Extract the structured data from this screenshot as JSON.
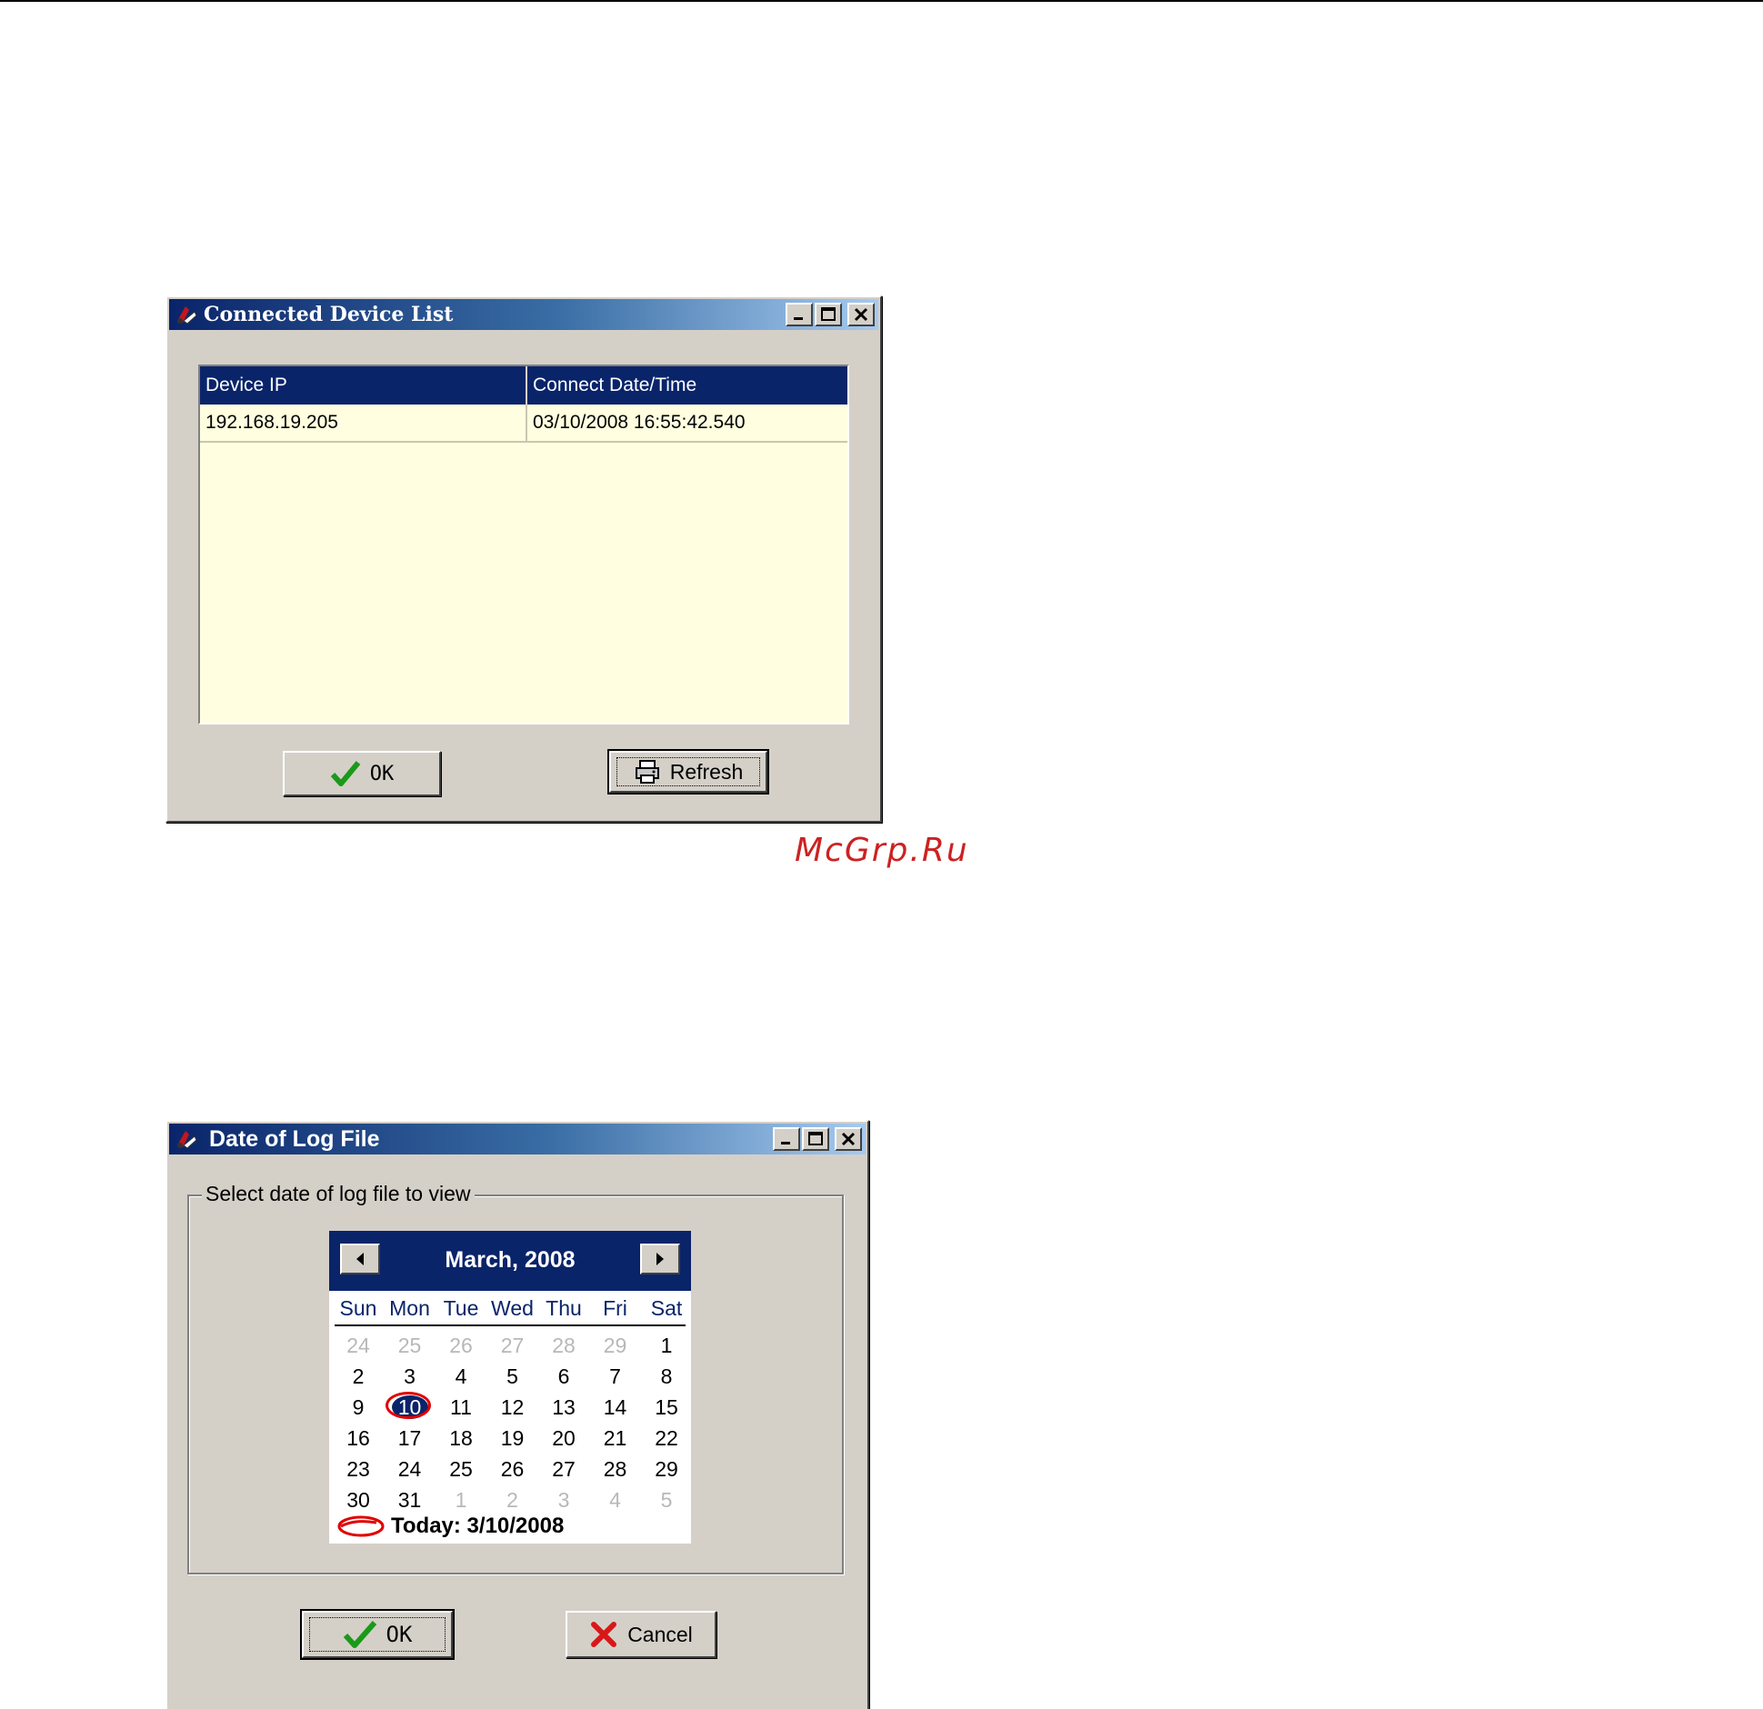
{
  "watermark": "McGrp.Ru",
  "device_list_window": {
    "title": "Connected Device List",
    "columns": [
      "Device IP",
      "Connect Date/Time"
    ],
    "rows": [
      [
        "192.168.19.205",
        "03/10/2008 16:55:42.540"
      ]
    ],
    "ok_label": "OK",
    "refresh_label": "Refresh"
  },
  "log_date_window": {
    "title": "Date of Log File",
    "group_label": "Select date of log file to view",
    "calendar": {
      "month_label": "March, 2008",
      "weekdays": [
        "Sun",
        "Mon",
        "Tue",
        "Wed",
        "Thu",
        "Fri",
        "Sat"
      ],
      "weeks": [
        [
          "24",
          "25",
          "26",
          "27",
          "28",
          "29",
          "1"
        ],
        [
          "2",
          "3",
          "4",
          "5",
          "6",
          "7",
          "8"
        ],
        [
          "9",
          "10",
          "11",
          "12",
          "13",
          "14",
          "15"
        ],
        [
          "16",
          "17",
          "18",
          "19",
          "20",
          "21",
          "22"
        ],
        [
          "23",
          "24",
          "25",
          "26",
          "27",
          "28",
          "29"
        ],
        [
          "30",
          "31",
          "1",
          "2",
          "3",
          "4",
          "5"
        ]
      ],
      "selected_day": "10",
      "today_label": "Today: 3/10/2008"
    },
    "ok_label": "OK",
    "cancel_label": "Cancel"
  },
  "colors": {
    "title_active": "#0a246a",
    "list_background": "#fffee0",
    "today_ring": "#e00000",
    "watermark": "#cc2222"
  }
}
